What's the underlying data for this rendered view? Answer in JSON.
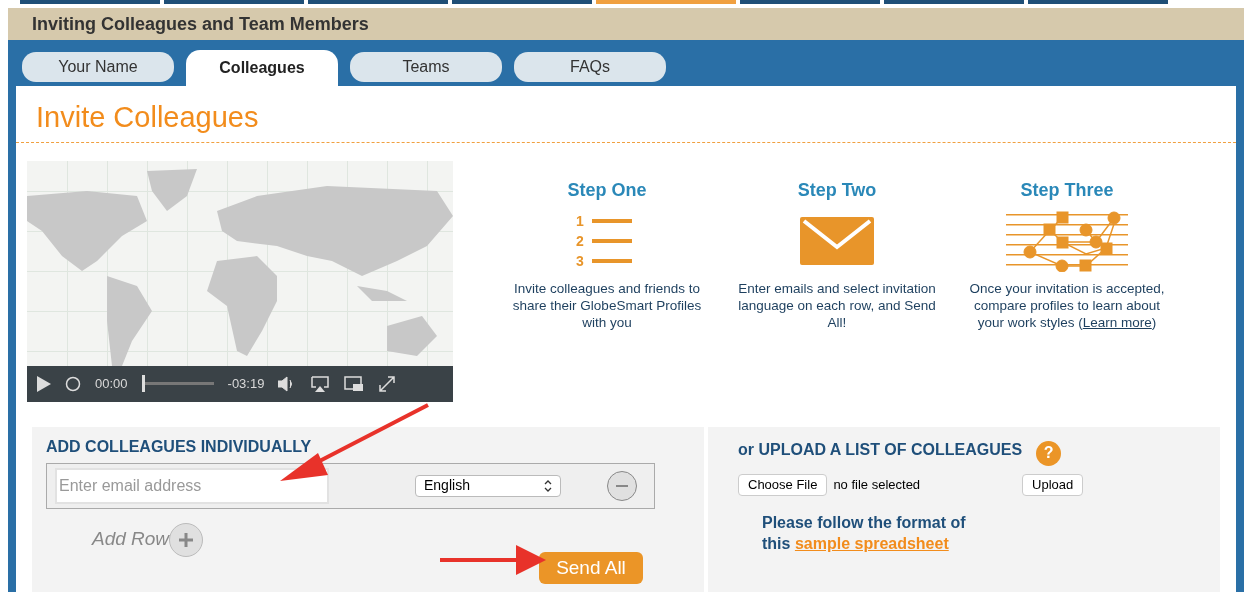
{
  "top_strip": [
    {
      "selected": false
    },
    {
      "selected": false
    },
    {
      "selected": false
    },
    {
      "selected": false
    },
    {
      "selected": true
    },
    {
      "selected": false
    },
    {
      "selected": false
    },
    {
      "selected": false
    }
  ],
  "window": {
    "title": "Inviting Colleagues and Team Members"
  },
  "tabs": [
    {
      "label": "Your Name",
      "selected": false
    },
    {
      "label": "Colleagues",
      "selected": true
    },
    {
      "label": "Teams",
      "selected": false
    },
    {
      "label": "FAQs",
      "selected": false
    }
  ],
  "heading": "Invite Colleagues",
  "video": {
    "elapsed": "00:00",
    "remaining": "-03:19",
    "level": 0.0
  },
  "steps": [
    {
      "title": "Step One",
      "kind": "list",
      "numbers": [
        "1",
        "2",
        "3"
      ],
      "text": "Invite colleagues and friends to share their GlobeSmart Profiles with you"
    },
    {
      "title": "Step Two",
      "kind": "envelope",
      "text": "Enter emails and select invitation language on each row, and Send All!"
    },
    {
      "title": "Step Three",
      "kind": "network",
      "text": "Once your invitation is accepted, compare profiles to learn about your work styles (",
      "link": "Learn more",
      "text_after": ")"
    }
  ],
  "individual": {
    "title": "ADD COLLEAGUES INDIVIDUALLY",
    "email_placeholder": "Enter email address",
    "language": "English",
    "add_row": "Add Row",
    "send_button": "Send All"
  },
  "upload": {
    "title": "or UPLOAD A LIST OF COLLEAGUES",
    "help": "?",
    "choose_button": "Choose File",
    "file_status": "no file selected",
    "upload_button": "Upload",
    "note": "Please follow the format of this ",
    "note_link": "sample spreadsheet"
  }
}
